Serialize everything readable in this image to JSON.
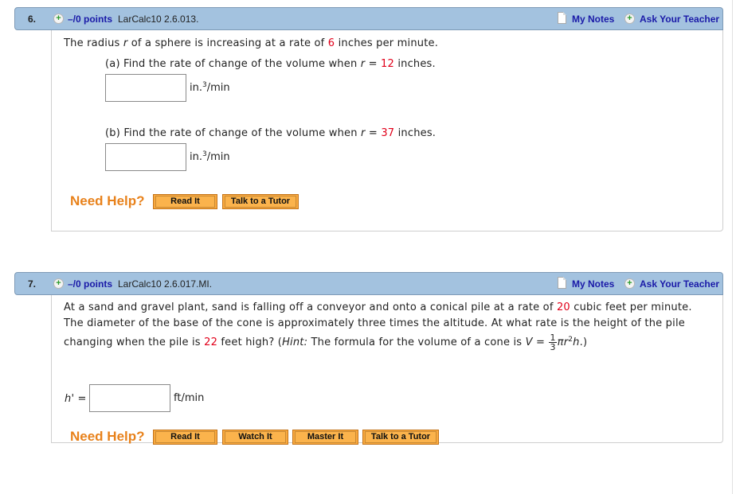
{
  "questions": [
    {
      "number": "6.",
      "points": "–/0 points",
      "code": "LarCalc10 2.6.013.",
      "my_notes": "My Notes",
      "ask_teacher": "Ask Your Teacher",
      "prompt": {
        "p1": "The radius ",
        "var_r": "r",
        "p2": " of a sphere is increasing at a rate of ",
        "rate": "6",
        "p3": " inches per minute."
      },
      "parts": [
        {
          "label": "(a)  Find the rate of change of the volume when ",
          "var": "r",
          "eq": " = ",
          "value": "12",
          "suffix": " inches.",
          "answer_value": "",
          "unit_base": "in.",
          "unit_exp": "3",
          "unit_tail": "/min"
        },
        {
          "label": "(b)  Find the rate of change of the volume when ",
          "var": "r",
          "eq": " = ",
          "value": "37",
          "suffix": " inches.",
          "answer_value": "",
          "unit_base": "in.",
          "unit_exp": "3",
          "unit_tail": "/min"
        }
      ],
      "need_help": "Need Help?",
      "help_buttons": [
        "Read It",
        "Talk to a Tutor"
      ]
    },
    {
      "number": "7.",
      "points": "–/0 points",
      "code": "LarCalc10 2.6.017.MI.",
      "my_notes": "My Notes",
      "ask_teacher": "Ask Your Teacher",
      "prompt": {
        "line1_a": "At a sand and gravel plant, sand is falling off a conveyor and onto a conical pile at a rate of ",
        "rate": "20",
        "line1_b": " cubic feet per minute.",
        "line2": "The diameter of the base of the cone is approximately three times the altitude. At what rate is the height of the pile",
        "line3_a": "changing when the pile is ",
        "height": "22",
        "line3_b": " feet high? (",
        "hint_label": "Hint:",
        "line3_c": " The formula for the volume of a cone is  ",
        "formula_lhs": "V",
        "formula_eq": " = ",
        "frac_num": "1",
        "frac_den": "3",
        "formula_pi": "π",
        "formula_r": "r",
        "formula_exp": "2",
        "formula_h": "h",
        "line3_d": ".)"
      },
      "answer_label": "h' =",
      "answer_value": "",
      "answer_unit": "ft/min",
      "need_help": "Need Help?",
      "help_buttons": [
        "Read It",
        "Watch It",
        "Master It",
        "Talk to a Tutor"
      ]
    }
  ],
  "colors": {
    "header_bg": "#a3c2df",
    "link_blue": "#1a1aa8",
    "value_red": "#e1001a",
    "help_orange": "#e8821c",
    "button_orange": "#f9a93e"
  }
}
